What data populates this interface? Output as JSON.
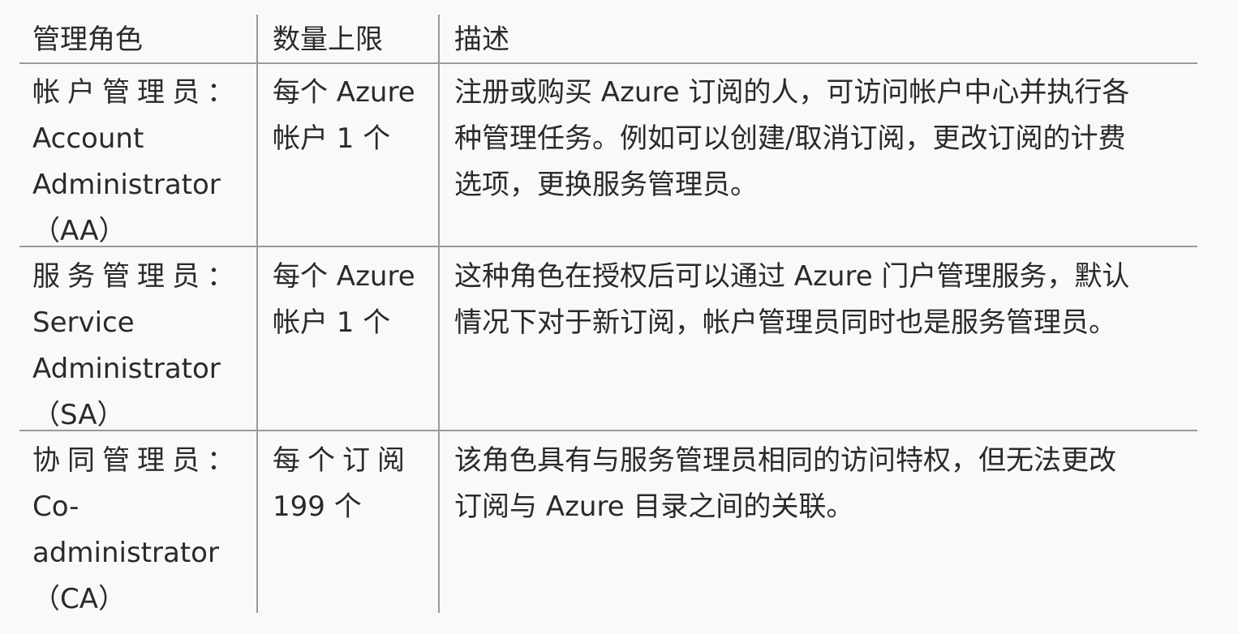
{
  "table": {
    "headers": [
      "管理角色",
      "数量上限",
      "描述"
    ],
    "rows": [
      {
        "role_lines": [
          "帐户管理员：",
          "Account",
          "Administrator",
          "（AA）"
        ],
        "limit_lines": [
          "每个 Azure",
          "帐户 1 个"
        ],
        "desc_lines": [
          "注册或购买 Azure 订阅的人，可访问帐户中心并执行各",
          "种管理任务。例如可以创建/取消订阅，更改订阅的计费",
          "选项，更换服务管理员。"
        ]
      },
      {
        "role_lines": [
          "服务管理员：",
          "Service",
          "Administrator",
          "（SA）"
        ],
        "limit_lines": [
          "每个 Azure",
          "帐户 1 个"
        ],
        "desc_lines": [
          "这种角色在授权后可以通过 Azure 门户管理服务，默认",
          "情况下对于新订阅，帐户管理员同时也是服务管理员。"
        ]
      },
      {
        "role_lines": [
          "协同管理员：",
          "Co-",
          "administrator",
          "（CA）"
        ],
        "limit_lines": [
          "每个订阅",
          "199 个"
        ],
        "desc_lines": [
          "该角色具有与服务管理员相同的访问特权，但无法更改",
          "订阅与 Azure 目录之间的关联。"
        ]
      }
    ]
  }
}
